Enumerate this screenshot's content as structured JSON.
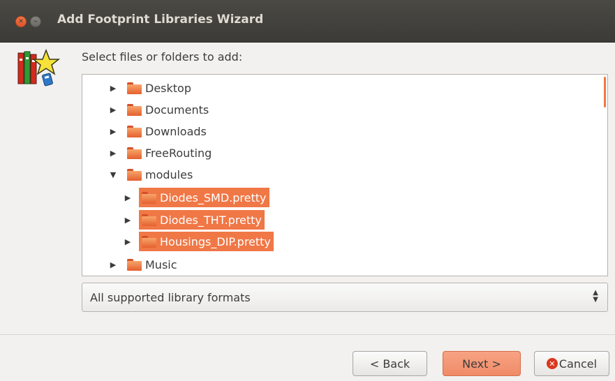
{
  "window": {
    "title": "Add Footprint Libraries Wizard",
    "close_glyph": "✕",
    "minimize_glyph": "–"
  },
  "prompt": "Select files or folders to add:",
  "tree": {
    "items": [
      {
        "label": "Desktop",
        "expander": "▶",
        "selected": false
      },
      {
        "label": "Documents",
        "expander": "▶",
        "selected": false
      },
      {
        "label": "Downloads",
        "expander": "▶",
        "selected": false
      },
      {
        "label": "FreeRouting",
        "expander": "▶",
        "selected": false
      },
      {
        "label": "modules",
        "expander": "▼",
        "selected": false
      },
      {
        "label": "Diodes_SMD.pretty",
        "expander": "▶",
        "selected": true
      },
      {
        "label": "Diodes_THT.pretty",
        "expander": "▶",
        "selected": true
      },
      {
        "label": "Housings_DIP.pretty",
        "expander": "▶",
        "selected": true
      },
      {
        "label": "Music",
        "expander": "▶",
        "selected": false
      }
    ]
  },
  "filter": {
    "selected": "All supported library formats",
    "spin_up": "▲",
    "spin_down": "▼"
  },
  "buttons": {
    "back": "< Back",
    "next": "Next >",
    "cancel": "Cancel",
    "cancel_glyph": "✕"
  },
  "colors": {
    "accent": "#f07746",
    "titlebar": "#3c3b37",
    "folder": "#e5602f"
  },
  "icons": {
    "wizard": "library-books-star-icon",
    "folder": "folder-icon",
    "cancel": "cancel-circle-icon"
  }
}
